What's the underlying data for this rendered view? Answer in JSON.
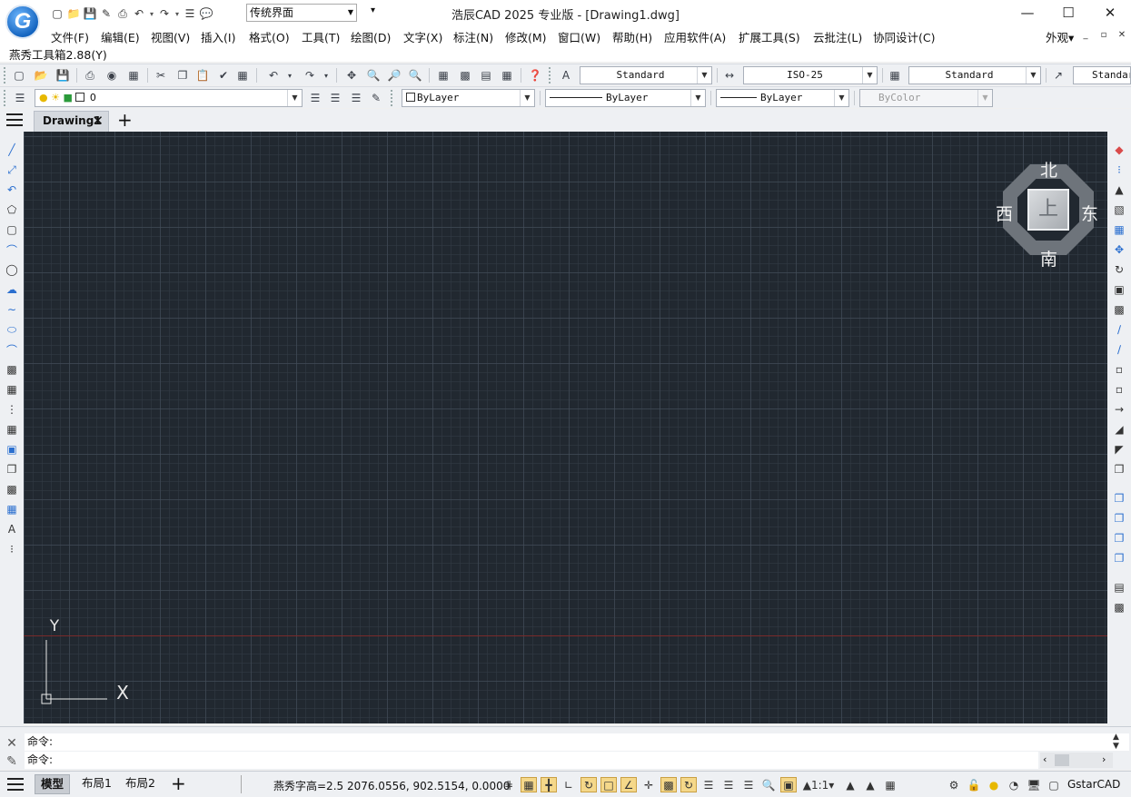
{
  "app": {
    "logo_letter": "G",
    "window_title": "浩辰CAD 2025 专业版 - [Drawing1.dwg]",
    "workspace": "传统界面",
    "window_controls": {
      "minimize": "—",
      "maximize": "☐",
      "close": "✕"
    }
  },
  "menu": {
    "items": [
      "文件(F)",
      "编辑(E)",
      "视图(V)",
      "插入(I)",
      "格式(O)",
      "工具(T)",
      "绘图(D)",
      "文字(X)",
      "标注(N)",
      "修改(M)",
      "窗口(W)",
      "帮助(H)",
      "应用软件(A)",
      "扩展工具(S)",
      "云批注(L)",
      "协同设计(C)"
    ],
    "appearance": "外观",
    "mdi_controls": [
      "_",
      "▫",
      "✕"
    ]
  },
  "plugin": {
    "label": "燕秀工具箱2.88(Y)"
  },
  "toolbar": {
    "text_style": "Standard",
    "dim_style": "ISO-25",
    "table_style": "Standard",
    "multileader_style": "Standard",
    "layer": "0",
    "color": "ByLayer",
    "linetype": "ByLayer",
    "lineweight": "ByLayer",
    "plotstyle": "ByColor"
  },
  "tabs": {
    "document": "Drawing1",
    "close": "✕",
    "add": "+"
  },
  "viewcube": {
    "top": "上",
    "north": "北",
    "south": "南",
    "east": "东",
    "west": "西"
  },
  "ucs": {
    "x_label": "X",
    "y_label": "Y"
  },
  "command": {
    "history_prompt": "命令:",
    "input_prompt": "命令:"
  },
  "status": {
    "tabs": [
      "模型",
      "布局1",
      "布局2"
    ],
    "add": "+",
    "coords": "燕秀字高=2.5  2076.0556, 902.5154, 0.0000",
    "scale": "1:1",
    "brand": "GstarCAD"
  },
  "colors": {
    "canvas": "#212830",
    "accent": "#2b6fcf",
    "ucs_red_line": "#7a2a2a"
  }
}
